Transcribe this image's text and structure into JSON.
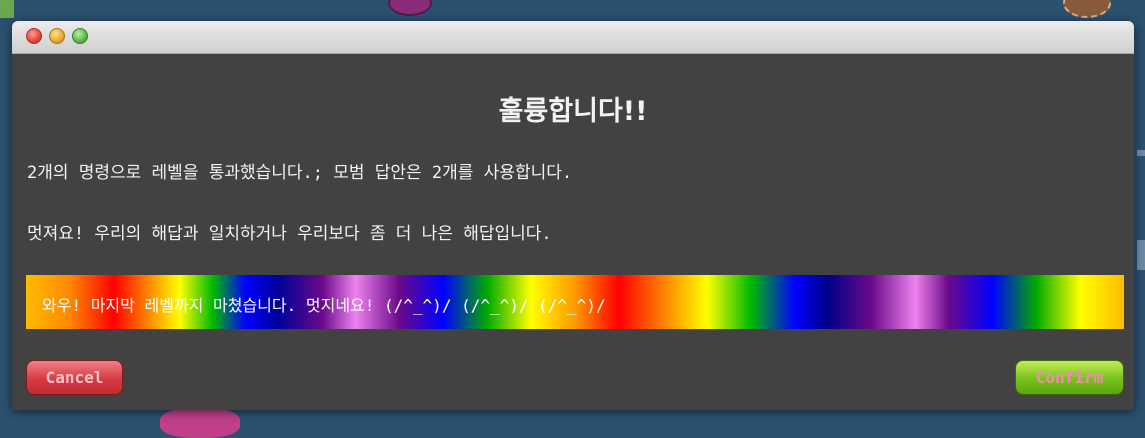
{
  "dialog": {
    "title": "훌륭합니다!!",
    "message_line1": "2개의 명령으로 레벨을 통과했습니다.; 모범 답안은 2개를 사용합니다.",
    "message_line2": "멋져요! 우리의 해답과 일치하거나 우리보다 좀 더 나은 해답입니다.",
    "rainbow_message": "와우! 마지막 레벨까지 마쳤습니다. 멋지네요! (/^_^)/ (/^_^)/ (/^_^)/",
    "cancel_label": "Cancel",
    "confirm_label": "Confirm"
  },
  "colors": {
    "window_bg": "#424242",
    "cancel_button": "#d63b43",
    "confirm_button": "#77c21a"
  }
}
